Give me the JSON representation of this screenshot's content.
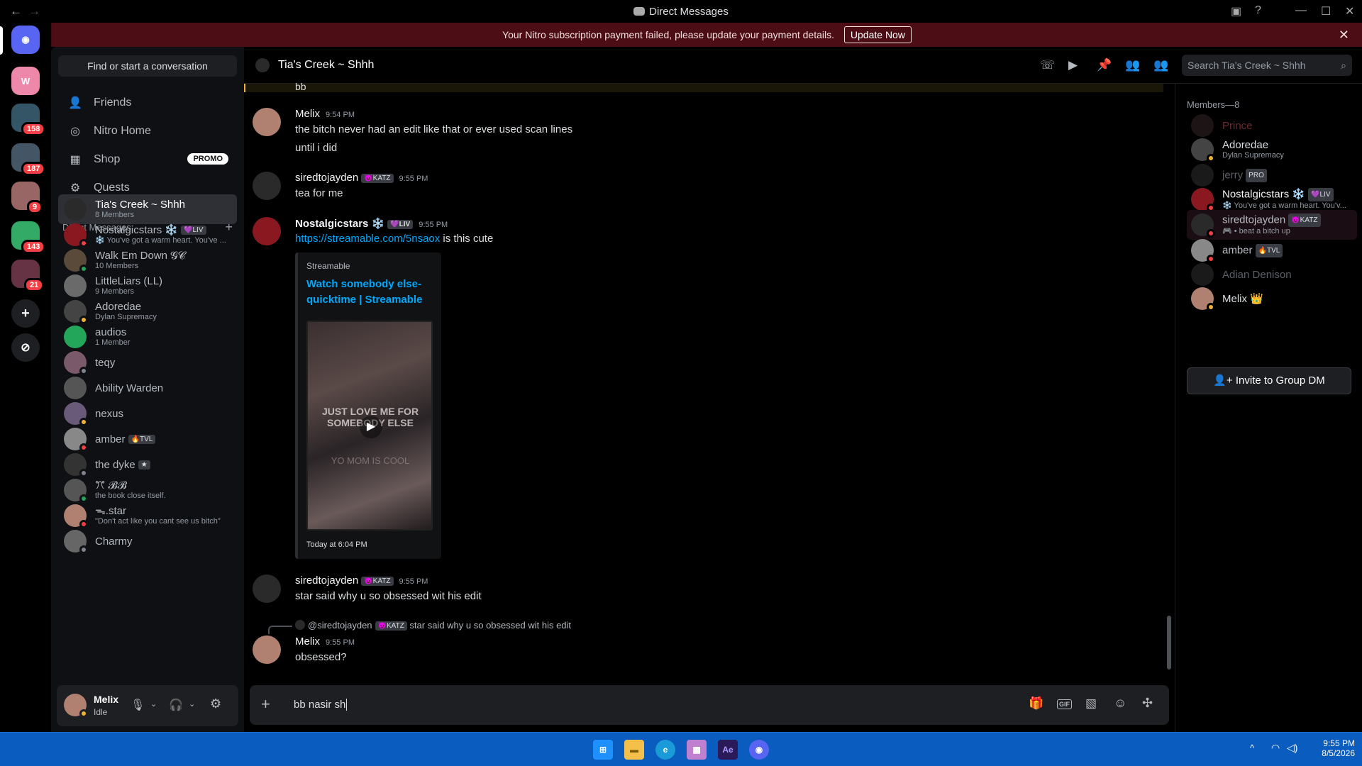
{
  "window": {
    "title": "Direct Messages"
  },
  "banner": {
    "text": "Your Nitro subscription payment failed, please update your payment details.",
    "button": "Update Now"
  },
  "servers": {
    "badges": [
      "158",
      "187",
      "9",
      "143",
      "21"
    ]
  },
  "sidebar": {
    "find_placeholder": "Find or start a conversation",
    "nav": [
      {
        "label": "Friends"
      },
      {
        "label": "Nitro Home"
      },
      {
        "label": "Shop",
        "badge": "PROMO"
      },
      {
        "label": "Quests"
      }
    ],
    "dm_header": "Direct Messages",
    "dms": [
      {
        "name": "Tia's Creek ~ Shhh",
        "sub": "8 Members",
        "color": "#2a2a2a"
      },
      {
        "name": "Nostalgicstars ❄️",
        "tag": "💜LIV",
        "sub": "❄️ You've got a warm heart. You've ...",
        "color": "#8a1820"
      },
      {
        "name": "Walk Em Down 𝓖𝓒",
        "sub": "10 Members",
        "color": "#5a4a3a"
      },
      {
        "name": "LittleLiars (LL)",
        "sub": "9 Members",
        "color": "#6a6a6a"
      },
      {
        "name": "Adoredae",
        "sub": "Dylan Supremacy",
        "color": "#444"
      },
      {
        "name": "audios",
        "sub": "1 Member",
        "color": "#23a55a"
      },
      {
        "name": "teqy",
        "sub": "",
        "color": "#7a5a6a"
      },
      {
        "name": "Ability Warden",
        "sub": "",
        "color": "#555"
      },
      {
        "name": "nexus",
        "sub": "",
        "color": "#6a5a7a"
      },
      {
        "name": "amber",
        "tag": "🔥TVL",
        "sub": "",
        "color": "#888"
      },
      {
        "name": "the dyke",
        "tag": "★",
        "sub": "",
        "color": "#333"
      },
      {
        "name": "ꔫ 𝓑𝓑",
        "sub": "the book close itself.",
        "color": "#555"
      },
      {
        "name": "ᯓ.star",
        "sub": "\"Don't act like you cant see us bitch\"",
        "color": "#b08070"
      },
      {
        "name": "Charmy",
        "sub": "",
        "color": "#666"
      }
    ]
  },
  "user": {
    "name": "Melix",
    "status": "Idle"
  },
  "chat": {
    "channel": "Tia's Creek ~ Shhh",
    "search_placeholder": "Search Tia's Creek ~ Shhh",
    "prev_text": "bb",
    "messages": [
      {
        "author": "Melix",
        "time": "9:54 PM",
        "lines": [
          "the bitch never had an edit like that or ever used scan lines",
          "until i did"
        ]
      },
      {
        "author": "siredtojayden",
        "tag": "😈KATZ",
        "time": "9:55 PM",
        "lines": [
          "tea for me"
        ]
      },
      {
        "author": "Nostalgicstars ❄️",
        "tag": "💜LIV",
        "time": "9:55 PM",
        "link": "https://streamable.com/5nsaox",
        "after": " is this cute"
      },
      {
        "author": "siredtojayden",
        "tag": "😈KATZ",
        "time": "9:55 PM",
        "lines": [
          "star said why u so obsessed wit his edit"
        ]
      },
      {
        "author": "Melix",
        "time": "9:55 PM",
        "lines": [
          "obsessed?"
        ],
        "reply_author": "@siredtojayden",
        "reply_tag": "😈KATZ",
        "reply_text": "star said why u so obsessed wit his edit"
      }
    ],
    "embed": {
      "provider": "Streamable",
      "title": "Watch somebody else-quicktime | Streamable",
      "thumb_text": "JUST LOVE ME FOR SOMEBODY ELSE",
      "thumb_sub": "YO MOM IS COOL",
      "footer": "Today at 6:04 PM"
    },
    "composer_text": "bb nasir sh"
  },
  "members": {
    "header": "Members—8",
    "list": [
      {
        "name": "Prince",
        "sub": "",
        "color": "#3a2a2a",
        "name_color": "#6b2a2e"
      },
      {
        "name": "Adoredae",
        "sub": "Dylan Supremacy",
        "color": "#444",
        "name_color": "#dbdee1"
      },
      {
        "name": "jerry",
        "tag": "PRO",
        "sub": "",
        "color": "#333",
        "name_color": "#5c5e66"
      },
      {
        "name": "Nostalgicstars ❄️",
        "tag": "💜LIV",
        "sub": "❄️ You've got a warm heart. You'v...",
        "color": "#8a1820",
        "name_color": "#f2f3f5"
      },
      {
        "name": "siredtojayden",
        "tag": "😈KATZ",
        "sub": "🎮 • beat a bitch up",
        "color": "#2a2a2a",
        "name_color": "#b5bac1"
      },
      {
        "name": "amber",
        "tag": "🔥TVL",
        "sub": "",
        "color": "#888",
        "name_color": "#b5bac1"
      },
      {
        "name": "Adian Denison",
        "sub": "",
        "color": "#333",
        "name_color": "#5c5e66"
      },
      {
        "name": "Melix 👑",
        "sub": "",
        "color": "#b08070",
        "name_color": "#dbdee1"
      }
    ],
    "invite": "Invite to Group DM"
  },
  "taskbar": {
    "time": "9:55 PM",
    "date": "8/5/2026"
  }
}
